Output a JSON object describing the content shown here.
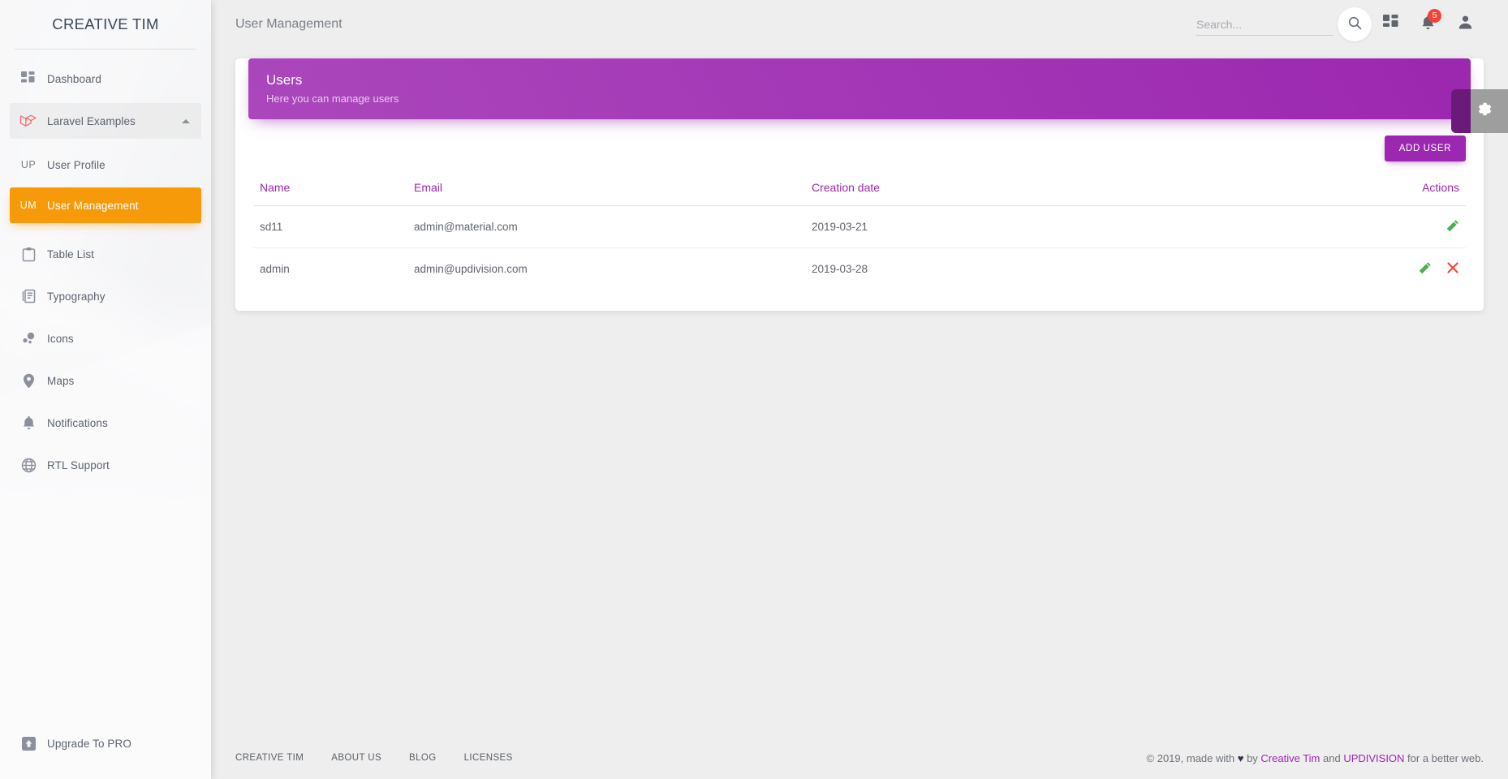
{
  "sidebar": {
    "brand": "CREATIVE TIM",
    "items": [
      {
        "label": "Dashboard",
        "icon": "dashboard-grid-icon",
        "state": "default"
      },
      {
        "label": "Laravel Examples",
        "icon": "laravel-icon",
        "state": "expanded",
        "caret": "chevron-up-icon"
      },
      {
        "label": "User Profile",
        "mini": "UP",
        "state": "default"
      },
      {
        "label": "User Management",
        "mini": "UM",
        "state": "active"
      },
      {
        "label": "Table List",
        "icon": "clipboard-icon",
        "state": "default"
      },
      {
        "label": "Typography",
        "icon": "text-document-icon",
        "state": "default"
      },
      {
        "label": "Icons",
        "icon": "bubbles-icon",
        "state": "default"
      },
      {
        "label": "Maps",
        "icon": "map-pin-icon",
        "state": "default"
      },
      {
        "label": "Notifications",
        "icon": "bell-icon",
        "state": "default"
      },
      {
        "label": "RTL Support",
        "icon": "globe-icon",
        "state": "default"
      }
    ],
    "upgrade": {
      "label": "Upgrade To PRO",
      "icon": "upgrade-box-icon"
    }
  },
  "navbar": {
    "page_title": "User Management",
    "search_placeholder": "Search...",
    "search_value": "",
    "search_icon": "magnifier-icon",
    "dashboard_icon": "dashboard-grid-icon",
    "notifications_icon": "bell-icon",
    "notifications_count": "5",
    "account_icon": "person-icon"
  },
  "card": {
    "title": "Users",
    "subtitle": "Here you can manage users",
    "add_button": "ADD USER",
    "columns": [
      "Name",
      "Email",
      "Creation date",
      "Actions"
    ],
    "rows": [
      {
        "name": "sd11",
        "email": "admin@material.com",
        "created": "2019-03-21",
        "actions": [
          "edit-pencil-icon"
        ]
      },
      {
        "name": "admin",
        "email": "admin@updivision.com",
        "created": "2019-03-28",
        "actions": [
          "edit-pencil-icon",
          "delete-x-icon"
        ]
      }
    ]
  },
  "footer": {
    "links": [
      "CREATIVE TIM",
      "ABOUT US",
      "BLOG",
      "LICENSES"
    ],
    "copy_prefix": "© 2019, made with ",
    "heart": "♥",
    "copy_by": " by ",
    "link1": "Creative Tim",
    "copy_and": " and ",
    "link2": "UPDIVISION",
    "copy_suffix": " for a better web."
  },
  "settings": {
    "icon": "gear-icon"
  },
  "colors": {
    "accent_purple": "#9c27b0",
    "active_orange": "#f79a0a",
    "badge_red": "#f44336",
    "edit_green": "#4caf50",
    "delete_red": "#f44336",
    "laravel_red": "#f4645f"
  }
}
